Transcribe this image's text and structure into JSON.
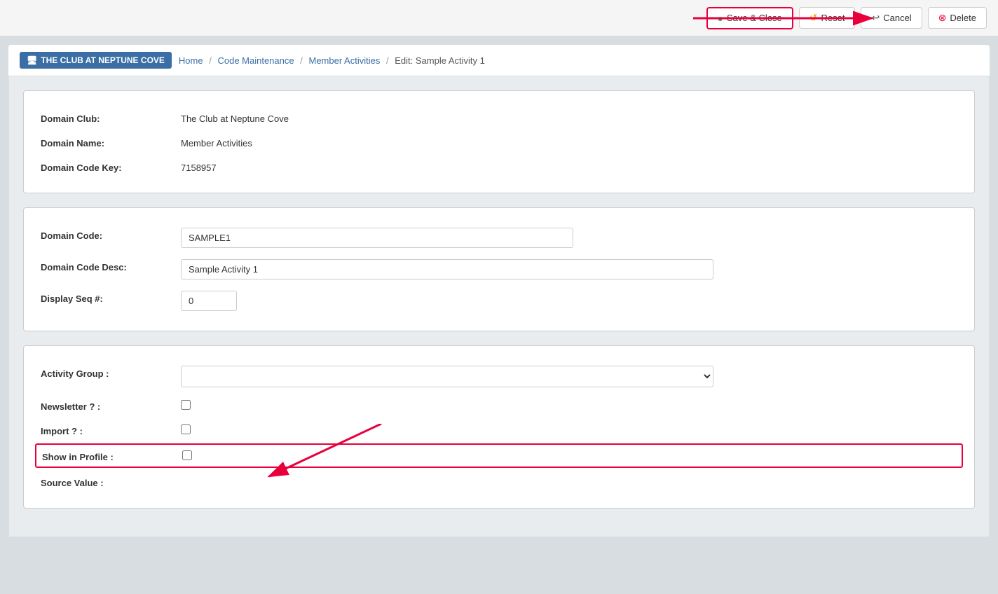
{
  "toolbar": {
    "save_close_label": "Save & Close",
    "reset_label": "Reset",
    "cancel_label": "Cancel",
    "delete_label": "Delete"
  },
  "breadcrumb": {
    "brand": "THE CLUB AT NEPTUNE COVE",
    "home": "Home",
    "code_maintenance": "Code Maintenance",
    "member_activities": "Member Activities",
    "edit_prefix": "Edit:",
    "edit_name": "Sample Activity 1"
  },
  "domain_info": {
    "domain_club_label": "Domain Club:",
    "domain_club_value": "The Club at Neptune Cove",
    "domain_name_label": "Domain Name:",
    "domain_name_value": "Member Activities",
    "domain_code_key_label": "Domain Code Key:",
    "domain_code_key_value": "7158957"
  },
  "domain_form": {
    "domain_code_label": "Domain Code:",
    "domain_code_value": "SAMPLE1",
    "domain_code_desc_label": "Domain Code Desc:",
    "domain_code_desc_value": "Sample Activity 1",
    "display_seq_label": "Display Seq #:",
    "display_seq_value": "0"
  },
  "activity_form": {
    "activity_group_label": "Activity Group :",
    "activity_group_value": "",
    "newsletter_label": "Newsletter ? :",
    "import_label": "Import ? :",
    "show_in_profile_label": "Show in Profile :",
    "source_value_label": "Source Value :"
  }
}
